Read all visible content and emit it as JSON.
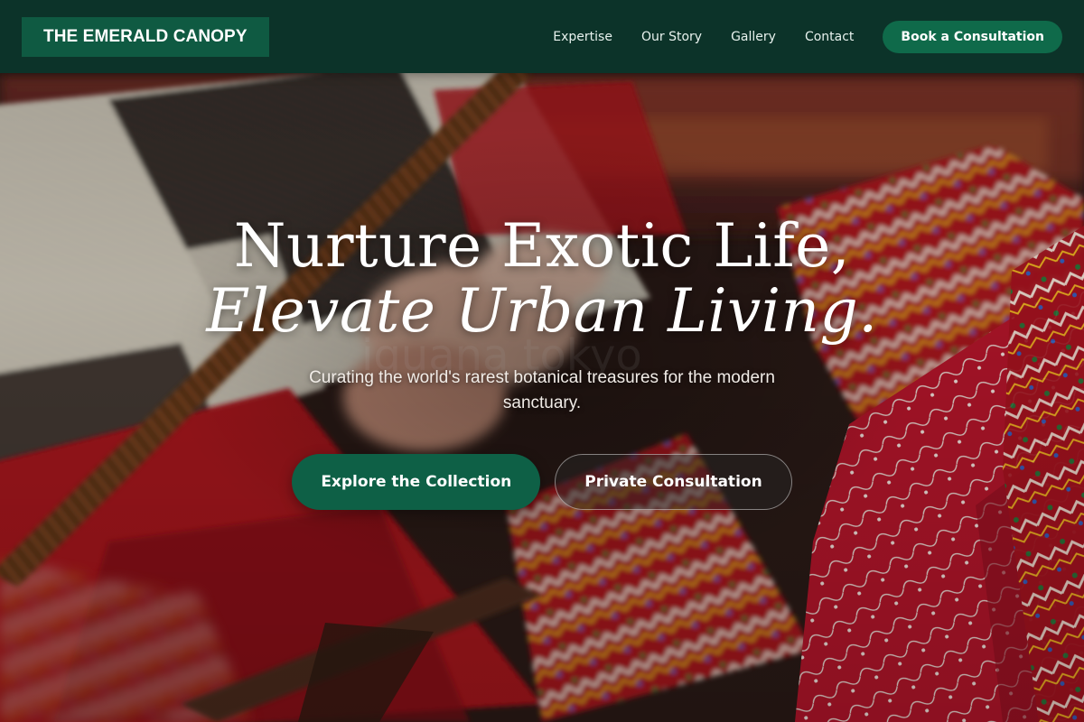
{
  "brand": {
    "name": "THE EMERALD CANOPY"
  },
  "nav": {
    "links": [
      {
        "label": "Expertise"
      },
      {
        "label": "Our Story"
      },
      {
        "label": "Gallery"
      },
      {
        "label": "Contact"
      }
    ],
    "cta_label": "Book a Consultation"
  },
  "hero": {
    "headline_line1": "Nurture Exotic Life,",
    "headline_line2": "Elevate Urban Living.",
    "subheadline": "Curating the world's rarest botanical treasures for the modern sanctuary.",
    "primary_cta": "Explore the Collection",
    "secondary_cta": "Private Consultation",
    "background_image": "loom-weaving-textile-photo"
  },
  "colors": {
    "nav_bg": "#0c3329",
    "brand_bg": "#0f5a42",
    "accent": "#0e6046",
    "text_light": "#ffffff"
  }
}
